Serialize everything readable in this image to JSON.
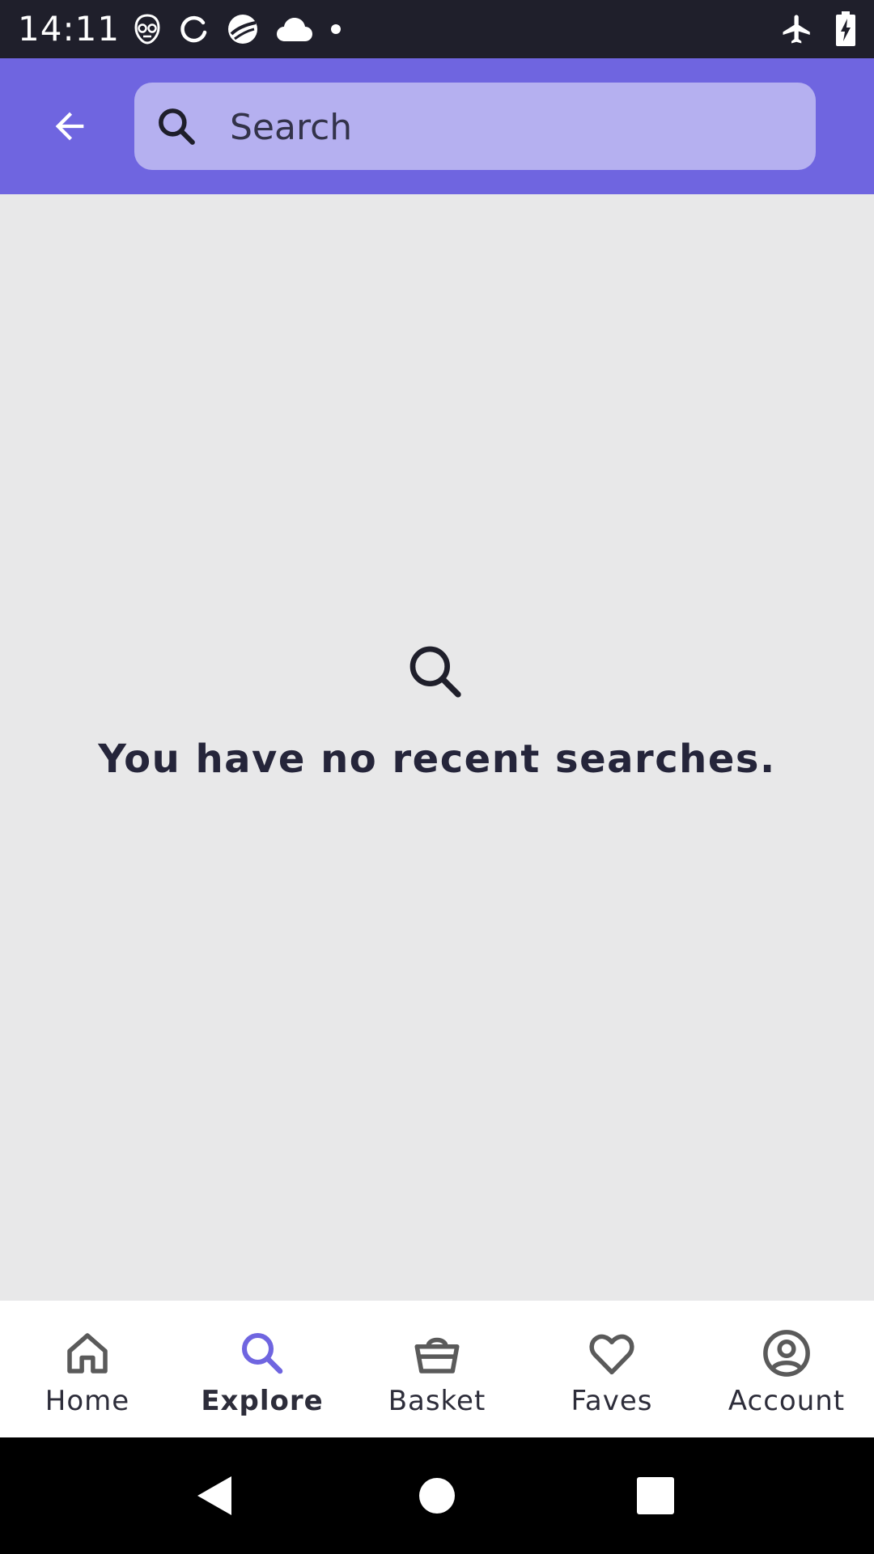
{
  "status_bar": {
    "time": "14:11",
    "left_icons": [
      "alien-face-icon",
      "sync-icon",
      "globe-app-icon",
      "cloud-icon",
      "dot-icon"
    ],
    "right_icons": [
      "airplane-mode-icon",
      "battery-charging-icon"
    ]
  },
  "app_bar": {
    "back_icon": "arrow-left-icon",
    "search": {
      "placeholder": "Search",
      "value": "",
      "icon": "search-icon"
    }
  },
  "empty_state": {
    "icon": "search-icon",
    "message": "You have no recent searches."
  },
  "bottom_nav": {
    "items": [
      {
        "label": "Home",
        "icon": "home-icon",
        "active": false
      },
      {
        "label": "Explore",
        "icon": "search-icon",
        "active": true
      },
      {
        "label": "Basket",
        "icon": "basket-icon",
        "active": false
      },
      {
        "label": "Faves",
        "icon": "heart-icon",
        "active": false
      },
      {
        "label": "Account",
        "icon": "account-icon",
        "active": false
      }
    ]
  },
  "system_nav": {
    "buttons": [
      "back-triangle-icon",
      "home-circle-icon",
      "recents-square-icon"
    ]
  },
  "colors": {
    "accent": "#6f65e0",
    "search_field": "#b5b0f0",
    "background": "#e8e8e9",
    "text": "#25253a"
  }
}
